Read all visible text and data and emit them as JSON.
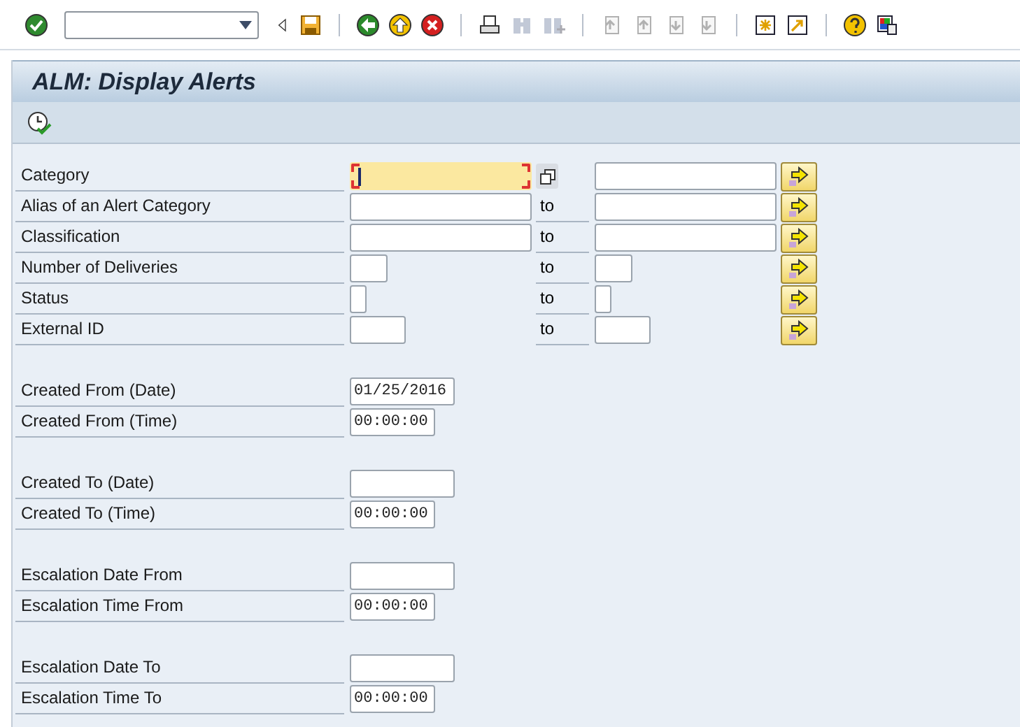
{
  "window": {
    "title": "ALM: Display Alerts"
  },
  "selection_groups": [
    {
      "rows": [
        {
          "label": "Category",
          "kind": "range_with_picker",
          "focused": true
        },
        {
          "label": "Alias of an Alert Category",
          "kind": "range",
          "to_label": "to",
          "focused": false
        },
        {
          "label": "Classification",
          "kind": "range",
          "to_label": "to",
          "focused": false
        },
        {
          "label": "Number of Deliveries",
          "kind": "range",
          "to_label": "to",
          "focused": false
        },
        {
          "label": "Status",
          "kind": "range",
          "to_label": "to",
          "focused": false
        },
        {
          "label": "External ID",
          "kind": "range",
          "to_label": "to",
          "focused": false
        }
      ]
    },
    {
      "rows": [
        {
          "label": "Created From (Date)",
          "kind": "date",
          "value": "01/25/2016"
        },
        {
          "label": "Created From (Time)",
          "kind": "time",
          "value": "00:00:00"
        }
      ]
    },
    {
      "rows": [
        {
          "label": "Created To (Date)",
          "kind": "date"
        },
        {
          "label": "Created To (Time)",
          "kind": "time",
          "value": "00:00:00"
        }
      ]
    },
    {
      "rows": [
        {
          "label": "Escalation Date From",
          "kind": "date"
        },
        {
          "label": "Escalation Time From",
          "kind": "time",
          "value": "00:00:00"
        }
      ]
    },
    {
      "rows": [
        {
          "label": "Escalation Date To",
          "kind": "date"
        },
        {
          "label": "Escalation Time To",
          "kind": "time",
          "value": "00:00:00"
        }
      ]
    }
  ]
}
